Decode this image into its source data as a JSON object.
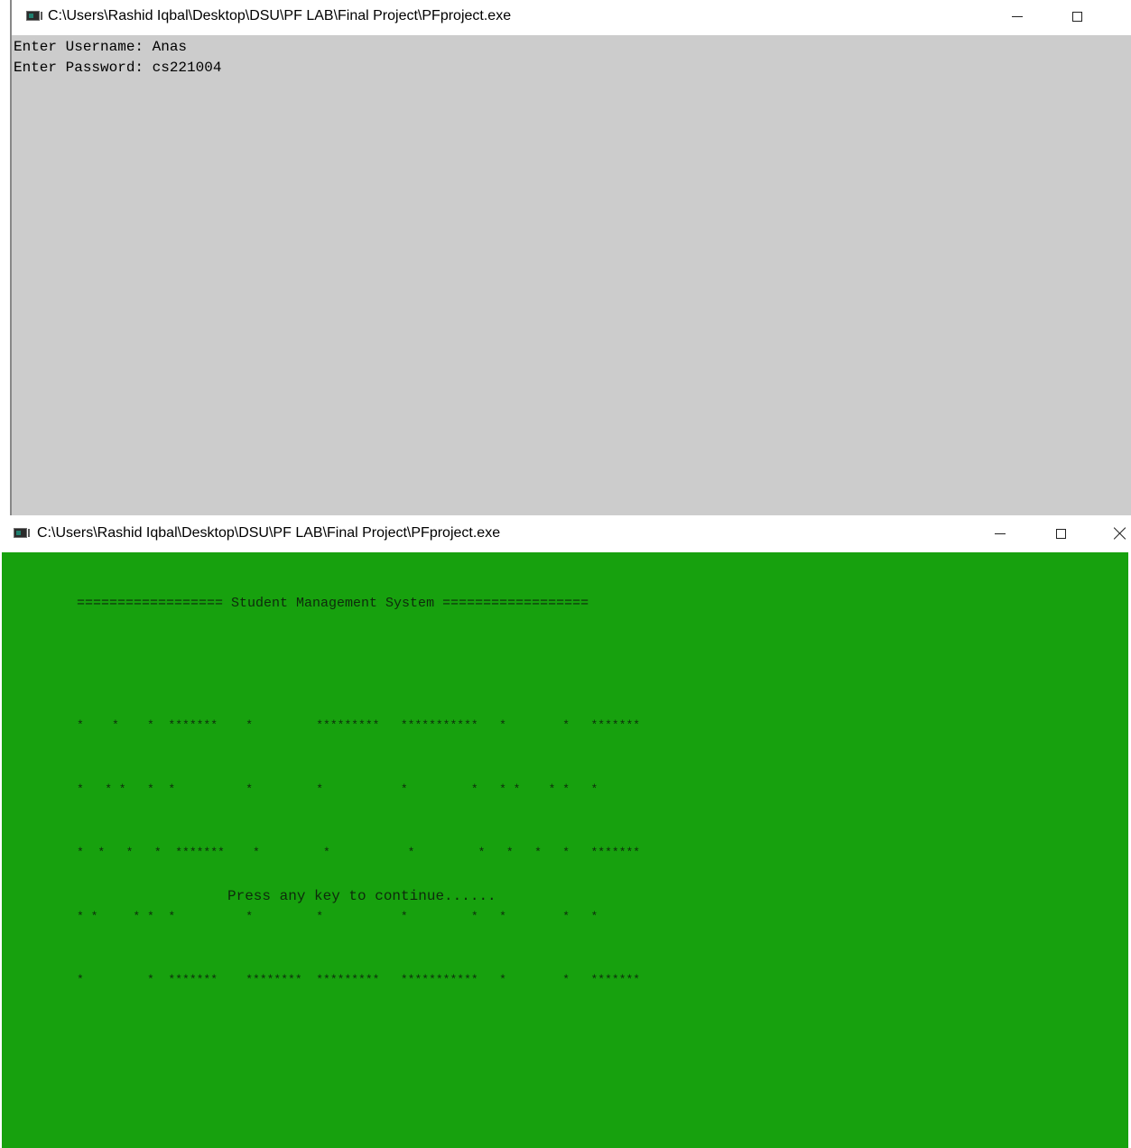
{
  "window1": {
    "title": "C:\\Users\\Rashid Iqbal\\Desktop\\DSU\\PF LAB\\Final Project\\PFproject.exe",
    "console_lines": [
      "Enter Username: Anas",
      "Enter Password: cs221004"
    ],
    "background": "#cccccc"
  },
  "window2": {
    "title": "C:\\Users\\Rashid Iqbal\\Desktop\\DSU\\PF LAB\\Final Project\\PFproject.exe",
    "banner": "================== Student Management System ==================",
    "art_lines": [
      "*    *    *  *******    *         *********   ***********   *        *   *******",
      "*   * *   *  *          *         *           *         *   * *    * *   *",
      "*  *   *   *  *******    *         *           *         *   *   *   *   *******",
      "* *     * *  *          *         *           *         *   *        *   *",
      "*         *  *******    ********  *********   ***********   *        *   *******"
    ],
    "press_text": "Press any key to continue......",
    "background": "#17a10e"
  },
  "icons": {
    "app": "console-app-icon",
    "minimize": "minimize-icon",
    "maximize": "maximize-icon",
    "close": "close-icon"
  }
}
